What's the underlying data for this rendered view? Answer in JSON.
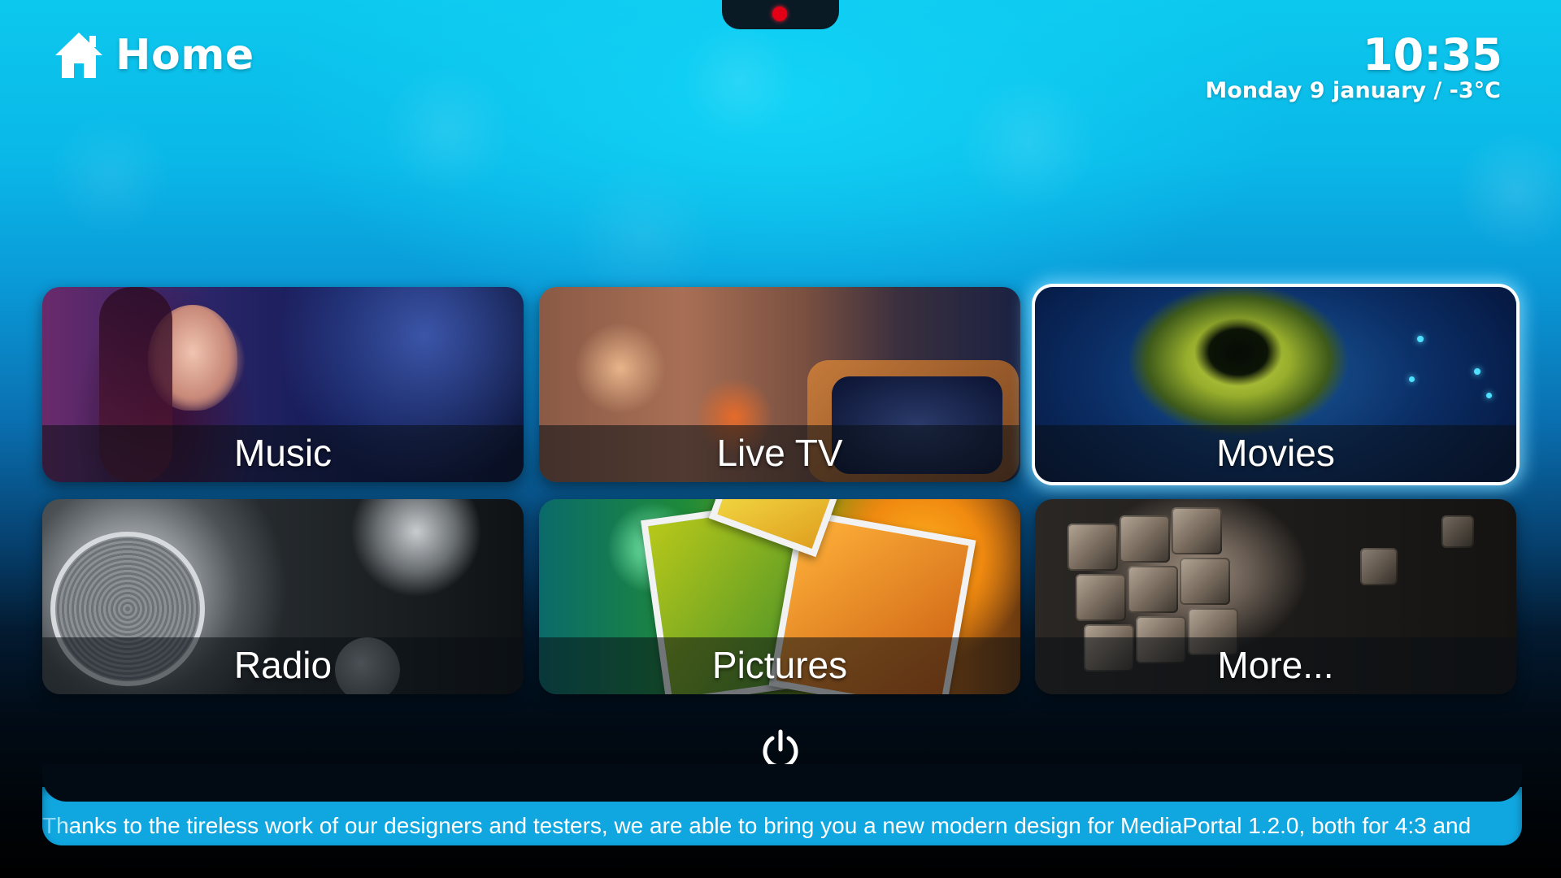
{
  "header": {
    "title": "Home",
    "icon": "home-icon"
  },
  "clock": {
    "time": "10:35",
    "date_weather": "Monday 9 january / -3°C"
  },
  "status": {
    "recording_indicator_color": "#e30016"
  },
  "menu": {
    "items": [
      {
        "label": "Music"
      },
      {
        "label": "Live TV"
      },
      {
        "label": "Movies",
        "selected": true
      },
      {
        "label": "Radio"
      },
      {
        "label": "Pictures"
      },
      {
        "label": "More..."
      }
    ]
  },
  "power": {
    "icon": "power-icon"
  },
  "ticker": {
    "text": "Thanks to the tireless work of our designers and testers, we are able to bring you a new modern design for MediaPortal 1.2.0, both for 4:3 and"
  },
  "colors": {
    "accent": "#10a6e0",
    "selection_glow": "#82dcff"
  }
}
